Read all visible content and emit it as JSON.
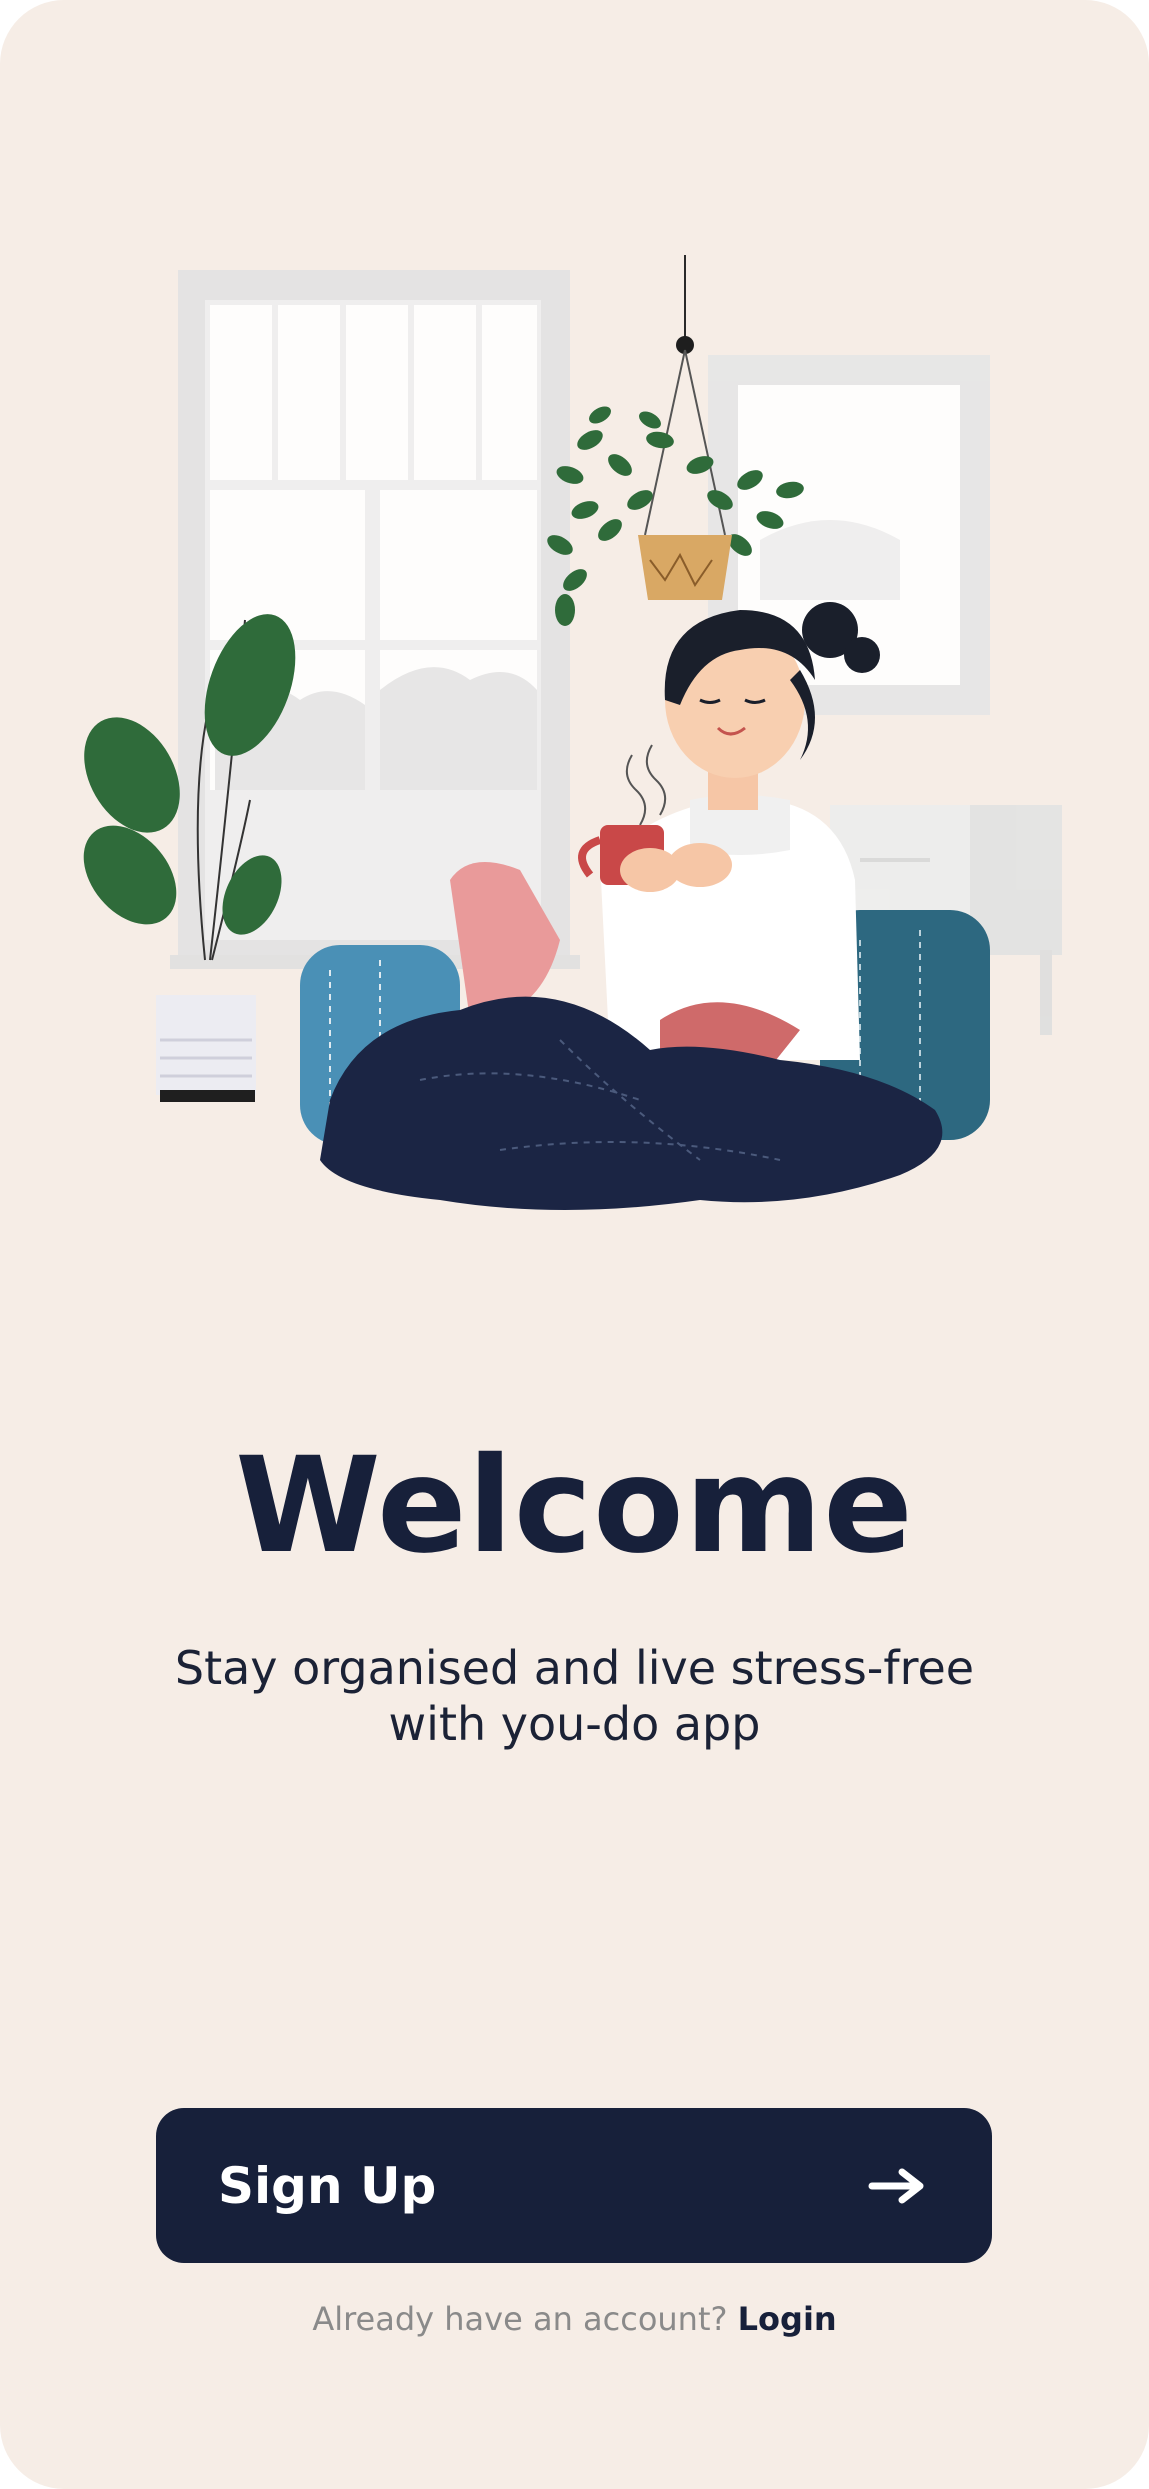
{
  "welcome": {
    "title": "Welcome",
    "subtitle": "Stay organised and live stress-free with you-do app"
  },
  "signup": {
    "label": "Sign Up",
    "icon": "arrow-right-icon"
  },
  "login": {
    "prompt": "Already have an account?",
    "link_label": "Login"
  },
  "illustration": {
    "description_icon": "relaxing-woman-illustration"
  },
  "colors": {
    "background": "#f6ede6",
    "primary": "#17203a",
    "muted_text": "#8a8a8a"
  }
}
